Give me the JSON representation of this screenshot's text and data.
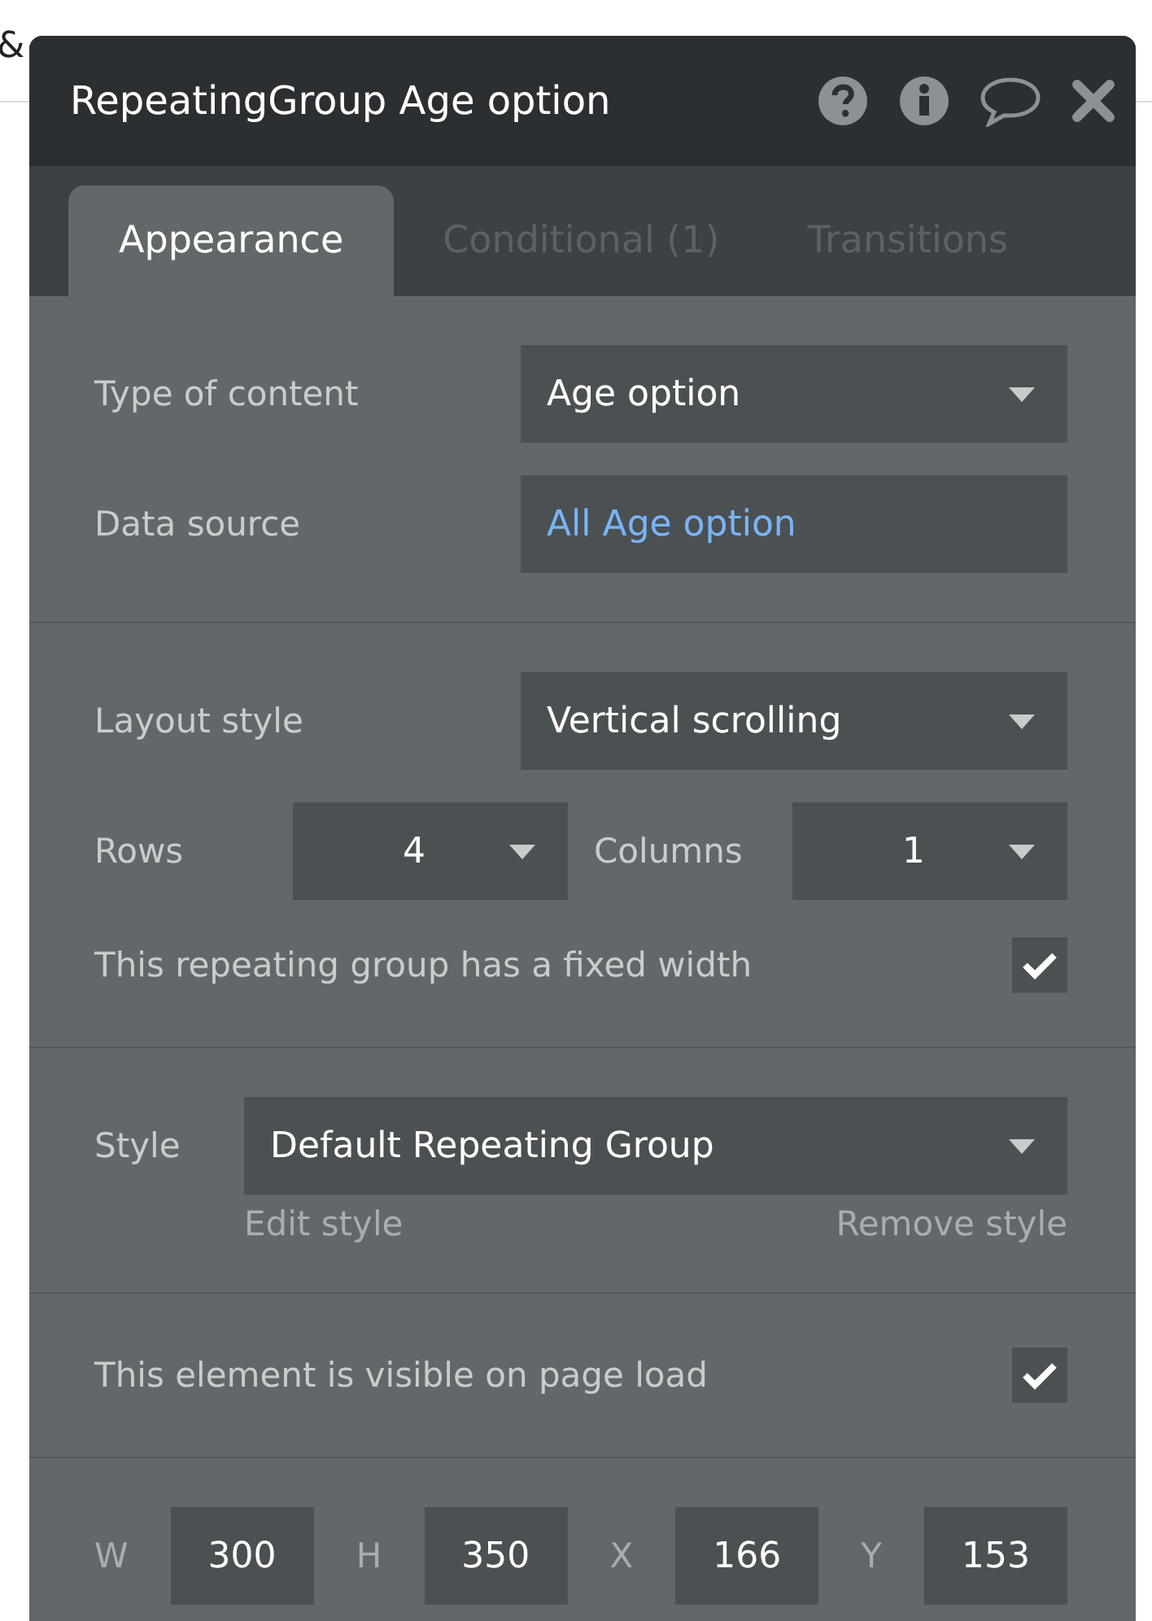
{
  "background": {
    "text": "&"
  },
  "window": {
    "title": "RepeatingGroup Age option"
  },
  "tabs": [
    {
      "label": "Appearance",
      "selected": true
    },
    {
      "label": "Conditional (1)",
      "selected": false
    },
    {
      "label": "Transitions",
      "selected": false
    }
  ],
  "sections": [
    {
      "rows": [
        {
          "kind": "dropdown",
          "label": "Type of content",
          "value": "Age option"
        },
        {
          "kind": "expression",
          "label": "Data source",
          "value": "All Age option"
        }
      ]
    },
    {
      "rows": [
        {
          "kind": "dropdown",
          "label": "Layout style",
          "value": "Vertical scrolling"
        },
        {
          "kind": "pair",
          "label": "Rows",
          "value": "4",
          "label2": "Columns",
          "value2": "1"
        },
        {
          "kind": "checkbox",
          "label": "This repeating group has a fixed width",
          "checked": true
        }
      ]
    },
    {
      "rows": [
        {
          "kind": "style",
          "label": "Style",
          "value": "Default Repeating Group",
          "link1": "Edit style",
          "link2": "Remove style"
        }
      ]
    },
    {
      "rows": [
        {
          "kind": "checkbox",
          "label": "This element is visible on page load",
          "checked": true
        }
      ]
    },
    {
      "rows": [
        {
          "kind": "dims",
          "items": [
            {
              "label": "W",
              "value": "300"
            },
            {
              "label": "H",
              "value": "350"
            },
            {
              "label": "X",
              "value": "166"
            },
            {
              "label": "Y",
              "value": "153"
            }
          ]
        }
      ]
    }
  ]
}
